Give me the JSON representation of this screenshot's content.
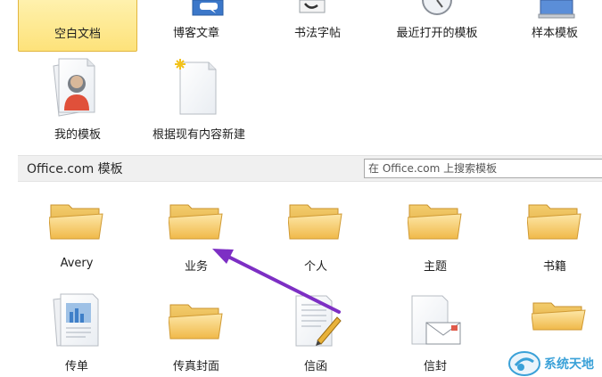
{
  "top_templates": [
    {
      "label": "空白文档"
    },
    {
      "label": "博客文章"
    },
    {
      "label": "书法字帖"
    },
    {
      "label": "最近打开的模板"
    },
    {
      "label": "样本模板"
    }
  ],
  "second_row": [
    {
      "label": "我的模板"
    },
    {
      "label": "根据现有内容新建"
    }
  ],
  "office_section": {
    "title": "Office.com 模板",
    "search_placeholder": "在 Office.com 上搜索模板"
  },
  "categories": [
    {
      "label": "Avery"
    },
    {
      "label": "业务"
    },
    {
      "label": "个人"
    },
    {
      "label": "主题"
    },
    {
      "label": "书籍"
    }
  ],
  "bottom_row": [
    {
      "label": "传单"
    },
    {
      "label": "传真封面"
    },
    {
      "label": "信函"
    },
    {
      "label": "信封"
    }
  ],
  "watermark": {
    "text": "系统天地"
  },
  "colors": {
    "selected_bg": "#fde27a",
    "folder": "#f5c85a",
    "arrow": "#7d2fc4",
    "watermark": "#3aa1d8"
  }
}
